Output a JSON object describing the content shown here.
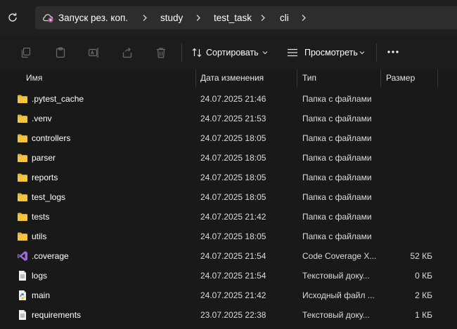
{
  "window": {
    "title": "cli"
  },
  "address_bar": {
    "refresh_icon": "refresh-icon",
    "crumbs": [
      {
        "label": "Запуск рез. коп.",
        "icon": "cloud-backup-icon"
      },
      {
        "label": "study"
      },
      {
        "label": "test_task"
      },
      {
        "label": "cli"
      }
    ]
  },
  "toolbar": {
    "icons": [
      "copy-icon",
      "paste-icon",
      "rename-icon",
      "share-icon",
      "delete-icon"
    ],
    "sort_label": "Сортировать",
    "view_label": "Просмотреть",
    "more_icon": "more-icon"
  },
  "columns": {
    "name": "Имя",
    "date": "Дата изменения",
    "type": "Тип",
    "size": "Размер"
  },
  "files": [
    {
      "name": ".pytest_cache",
      "date": "24.07.2025 21:46",
      "type": "Папка с файлами",
      "size": "",
      "icon": "folder"
    },
    {
      "name": ".venv",
      "date": "24.07.2025 21:53",
      "type": "Папка с файлами",
      "size": "",
      "icon": "folder"
    },
    {
      "name": "controllers",
      "date": "24.07.2025 18:05",
      "type": "Папка с файлами",
      "size": "",
      "icon": "folder"
    },
    {
      "name": "parser",
      "date": "24.07.2025 18:05",
      "type": "Папка с файлами",
      "size": "",
      "icon": "folder"
    },
    {
      "name": "reports",
      "date": "24.07.2025 18:05",
      "type": "Папка с файлами",
      "size": "",
      "icon": "folder"
    },
    {
      "name": "test_logs",
      "date": "24.07.2025 18:05",
      "type": "Папка с файлами",
      "size": "",
      "icon": "folder"
    },
    {
      "name": "tests",
      "date": "24.07.2025 21:42",
      "type": "Папка с файлами",
      "size": "",
      "icon": "folder"
    },
    {
      "name": "utils",
      "date": "24.07.2025 18:05",
      "type": "Папка с файлами",
      "size": "",
      "icon": "folder"
    },
    {
      "name": ".coverage",
      "date": "24.07.2025 21:54",
      "type": "Code Coverage X...",
      "size": "52 КБ",
      "icon": "visual-studio"
    },
    {
      "name": "logs",
      "date": "24.07.2025 21:54",
      "type": "Текстовый доку...",
      "size": "0 КБ",
      "icon": "text-file"
    },
    {
      "name": "main",
      "date": "24.07.2025 21:42",
      "type": "Исходный файл ...",
      "size": "2 КБ",
      "icon": "python-file"
    },
    {
      "name": "requirements",
      "date": "23.07.2025 22:38",
      "type": "Текстовый доку...",
      "size": "1 КБ",
      "icon": "text-file"
    }
  ],
  "colors": {
    "background": "#191919",
    "folder": "#f4c63d",
    "visual_studio": "#9b6ad9",
    "crumb_bar": "#2d2d2d"
  }
}
